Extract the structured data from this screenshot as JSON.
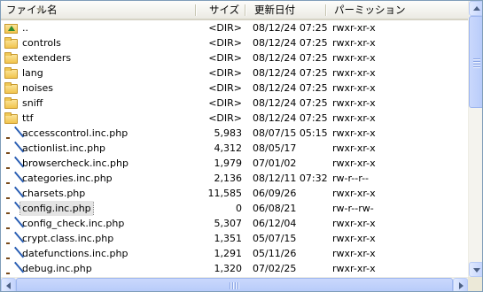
{
  "columns": {
    "name": "ファイル名",
    "size": "サイズ",
    "date": "更新日付",
    "perm": "パーミッション"
  },
  "files": [
    {
      "icon": "up-folder-icon",
      "name": "..",
      "size": "<DIR>",
      "date": "08/12/24 07:25",
      "perm": "rwxr-xr-x",
      "selected": false
    },
    {
      "icon": "folder-icon",
      "name": "controls",
      "size": "<DIR>",
      "date": "08/12/24 07:25",
      "perm": "rwxr-xr-x",
      "selected": false
    },
    {
      "icon": "folder-icon",
      "name": "extenders",
      "size": "<DIR>",
      "date": "08/12/24 07:25",
      "perm": "rwxr-xr-x",
      "selected": false
    },
    {
      "icon": "folder-icon",
      "name": "lang",
      "size": "<DIR>",
      "date": "08/12/24 07:25",
      "perm": "rwxr-xr-x",
      "selected": false
    },
    {
      "icon": "folder-icon",
      "name": "noises",
      "size": "<DIR>",
      "date": "08/12/24 07:25",
      "perm": "rwxr-xr-x",
      "selected": false
    },
    {
      "icon": "folder-icon",
      "name": "sniff",
      "size": "<DIR>",
      "date": "08/12/24 07:25",
      "perm": "rwxr-xr-x",
      "selected": false
    },
    {
      "icon": "folder-icon",
      "name": "ttf",
      "size": "<DIR>",
      "date": "08/12/24 07:25",
      "perm": "rwxr-xr-x",
      "selected": false
    },
    {
      "icon": "php-file-icon",
      "name": "accesscontrol.inc.php",
      "size": "5,983",
      "date": "08/07/15 05:15",
      "perm": "rwxr-xr-x",
      "selected": false
    },
    {
      "icon": "php-file-icon",
      "name": "actionlist.inc.php",
      "size": "4,312",
      "date": "08/05/17",
      "perm": "rwxr-xr-x",
      "selected": false
    },
    {
      "icon": "php-file-icon",
      "name": "browsercheck.inc.php",
      "size": "1,979",
      "date": "07/01/02",
      "perm": "rwxr-xr-x",
      "selected": false
    },
    {
      "icon": "php-file-icon",
      "name": "categories.inc.php",
      "size": "2,136",
      "date": "08/12/11 07:32",
      "perm": "rw-r--r--",
      "selected": false
    },
    {
      "icon": "php-file-icon",
      "name": "charsets.php",
      "size": "11,585",
      "date": "06/09/26",
      "perm": "rwxr-xr-x",
      "selected": false
    },
    {
      "icon": "php-file-icon",
      "name": "config.inc.php",
      "size": "0",
      "date": "06/08/21",
      "perm": "rw-r--rw-",
      "selected": true
    },
    {
      "icon": "php-file-icon",
      "name": "config_check.inc.php",
      "size": "5,307",
      "date": "06/12/04",
      "perm": "rwxr-xr-x",
      "selected": false
    },
    {
      "icon": "php-file-icon",
      "name": "crypt.class.inc.php",
      "size": "1,351",
      "date": "05/07/15",
      "perm": "rwxr-xr-x",
      "selected": false
    },
    {
      "icon": "php-file-icon",
      "name": "datefunctions.inc.php",
      "size": "1,291",
      "date": "05/11/26",
      "perm": "rwxr-xr-x",
      "selected": false
    },
    {
      "icon": "php-file-icon",
      "name": "debug.inc.php",
      "size": "1,320",
      "date": "07/02/25",
      "perm": "rwxr-xr-x",
      "selected": false
    }
  ],
  "colors": {
    "selection": "#e4e4e4",
    "border": "#7f9db9",
    "scrollbar": "#c3d3fd"
  }
}
